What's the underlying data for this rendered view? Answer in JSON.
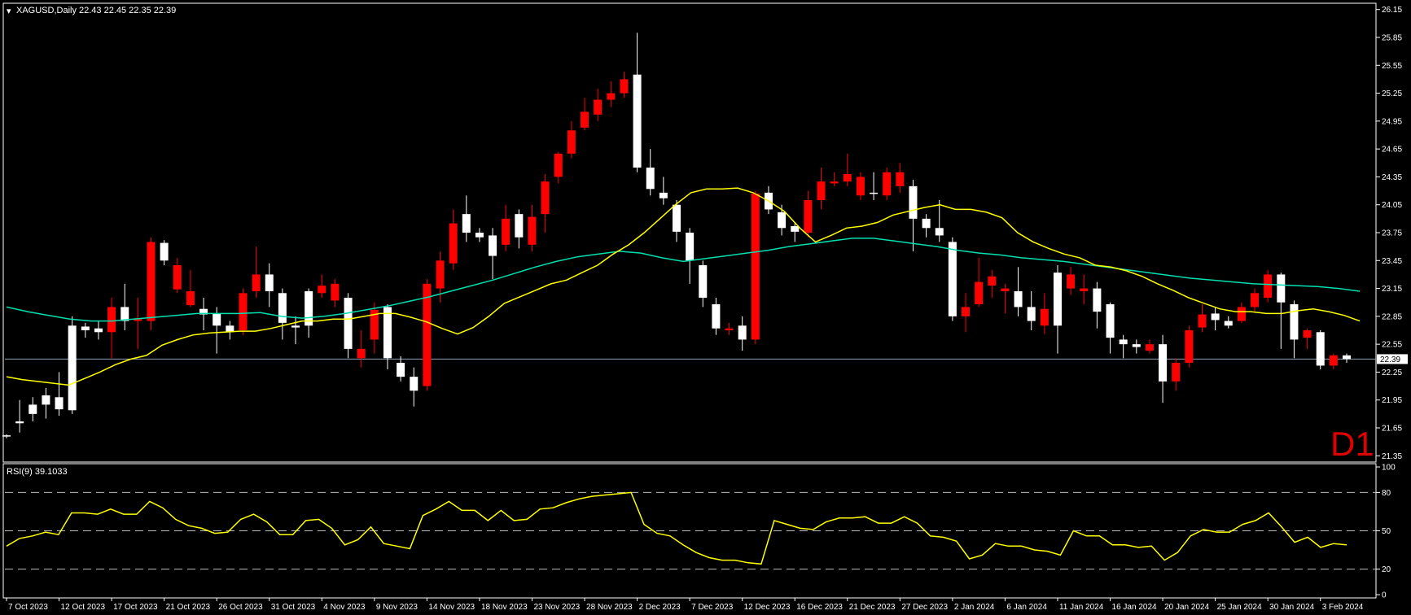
{
  "header": {
    "symbol_line": "XAGUSD,Daily  22.43 22.45 22.35 22.39",
    "timeframe_badge": "D1",
    "rsi_label": "RSI(9) 39.1033",
    "current_price_label": "22.39"
  },
  "colors": {
    "background": "#000000",
    "bull_candle": "#ffffff",
    "bear_candle": "#ff0000",
    "ma_fast": "#ffff00",
    "ma_slow": "#00e0b0",
    "rsi_line": "#ffff00",
    "grid_text": "#ffffff",
    "price_line": "#8fa3b8"
  },
  "chart_data": [
    {
      "type": "candlestick",
      "symbol": "XAGUSD",
      "period": "Daily",
      "ylim": [
        21.3,
        26.2
      ],
      "y_ticks": [
        "26.15",
        "25.85",
        "25.55",
        "25.25",
        "24.95",
        "24.65",
        "24.35",
        "24.05",
        "23.75",
        "23.45",
        "23.15",
        "22.85",
        "22.55",
        "22.25",
        "21.95",
        "21.65",
        "21.35"
      ],
      "x_labels": [
        "7 Oct 2023",
        "12 Oct 2023",
        "17 Oct 2023",
        "21 Oct 2023",
        "26 Oct 2023",
        "31 Oct 2023",
        "4 Nov 2023",
        "9 Nov 2023",
        "14 Nov 2023",
        "18 Nov 2023",
        "23 Nov 2023",
        "28 Nov 2023",
        "2 Dec 2023",
        "7 Dec 2023",
        "12 Dec 2023",
        "16 Dec 2023",
        "21 Dec 2023",
        "27 Dec 2023",
        "2 Jan 2024",
        "6 Jan 2024",
        "11 Jan 2024",
        "16 Jan 2024",
        "20 Jan 2024",
        "25 Jan 2024",
        "30 Jan 2024",
        "3 Feb 2024"
      ],
      "current_price": 22.39,
      "candles": [
        [
          21.56,
          21.58,
          21.54,
          21.57
        ],
        [
          21.7,
          21.95,
          21.6,
          21.72
        ],
        [
          21.8,
          21.98,
          21.72,
          21.9
        ],
        [
          21.9,
          22.08,
          21.75,
          22.0
        ],
        [
          21.85,
          22.25,
          21.78,
          21.98
        ],
        [
          21.84,
          22.85,
          21.8,
          22.75
        ],
        [
          22.7,
          22.78,
          22.62,
          22.74
        ],
        [
          22.68,
          22.8,
          22.6,
          22.72
        ],
        [
          22.95,
          23.05,
          22.4,
          22.68
        ],
        [
          22.8,
          23.2,
          22.7,
          22.95
        ],
        [
          22.82,
          23.05,
          22.5,
          22.8
        ],
        [
          23.65,
          23.7,
          22.7,
          22.8
        ],
        [
          23.45,
          23.67,
          23.4,
          23.64
        ],
        [
          23.4,
          23.48,
          23.1,
          23.14
        ],
        [
          23.12,
          23.35,
          22.95,
          22.97
        ],
        [
          22.87,
          23.05,
          22.7,
          22.93
        ],
        [
          22.75,
          22.95,
          22.45,
          22.88
        ],
        [
          22.68,
          22.8,
          22.6,
          22.75
        ],
        [
          23.1,
          23.15,
          22.65,
          22.7
        ],
        [
          23.3,
          23.6,
          23.05,
          23.12
        ],
        [
          23.12,
          23.42,
          22.95,
          23.3
        ],
        [
          22.78,
          23.15,
          22.6,
          23.1
        ],
        [
          22.73,
          22.85,
          22.55,
          22.75
        ],
        [
          22.75,
          23.15,
          22.62,
          23.12
        ],
        [
          23.18,
          23.3,
          23.05,
          23.1
        ],
        [
          23.2,
          23.25,
          22.95,
          23.02
        ],
        [
          22.5,
          23.1,
          22.4,
          23.05
        ],
        [
          22.5,
          22.7,
          22.3,
          22.4
        ],
        [
          22.92,
          23.0,
          22.45,
          22.6
        ],
        [
          22.4,
          22.98,
          22.28,
          22.95
        ],
        [
          22.2,
          22.42,
          22.15,
          22.35
        ],
        [
          22.05,
          22.3,
          21.88,
          22.2
        ],
        [
          23.2,
          23.25,
          22.05,
          22.1
        ],
        [
          23.45,
          23.55,
          23.0,
          23.15
        ],
        [
          23.85,
          24.0,
          23.35,
          23.42
        ],
        [
          23.75,
          24.15,
          23.65,
          23.95
        ],
        [
          23.7,
          23.8,
          23.65,
          23.75
        ],
        [
          23.5,
          23.8,
          23.25,
          23.72
        ],
        [
          23.9,
          24.05,
          23.55,
          23.62
        ],
        [
          23.7,
          24.0,
          23.58,
          23.95
        ],
        [
          23.92,
          24.05,
          23.55,
          23.62
        ],
        [
          24.3,
          24.38,
          23.75,
          23.95
        ],
        [
          24.6,
          24.62,
          24.28,
          24.35
        ],
        [
          24.85,
          24.95,
          24.55,
          24.6
        ],
        [
          25.05,
          25.2,
          24.85,
          24.88
        ],
        [
          25.18,
          25.3,
          24.95,
          25.02
        ],
        [
          25.25,
          25.38,
          25.1,
          25.18
        ],
        [
          25.4,
          25.48,
          25.2,
          25.25
        ],
        [
          24.45,
          25.9,
          24.4,
          25.45
        ],
        [
          24.22,
          24.65,
          24.15,
          24.45
        ],
        [
          24.12,
          24.35,
          24.05,
          24.18
        ],
        [
          23.76,
          24.1,
          23.65,
          24.05
        ],
        [
          23.45,
          23.8,
          23.2,
          23.75
        ],
        [
          23.05,
          23.45,
          22.95,
          23.4
        ],
        [
          22.72,
          23.05,
          22.65,
          22.98
        ],
        [
          22.72,
          22.78,
          22.65,
          22.7
        ],
        [
          22.6,
          22.85,
          22.48,
          22.75
        ],
        [
          24.17,
          24.2,
          22.55,
          22.6
        ],
        [
          24.0,
          24.25,
          23.95,
          24.18
        ],
        [
          23.8,
          24.05,
          23.72,
          23.97
        ],
        [
          23.76,
          23.85,
          23.65,
          23.82
        ],
        [
          24.1,
          24.2,
          23.7,
          23.75
        ],
        [
          24.3,
          24.45,
          24.0,
          24.1
        ],
        [
          24.3,
          24.4,
          24.25,
          24.28
        ],
        [
          24.38,
          24.6,
          24.25,
          24.3
        ],
        [
          24.35,
          24.4,
          24.1,
          24.15
        ],
        [
          24.17,
          24.4,
          24.1,
          24.18
        ],
        [
          24.4,
          24.45,
          24.1,
          24.15
        ],
        [
          24.4,
          24.5,
          24.18,
          24.25
        ],
        [
          23.9,
          24.32,
          23.55,
          24.25
        ],
        [
          23.8,
          23.95,
          23.7,
          23.9
        ],
        [
          23.72,
          24.1,
          23.65,
          23.8
        ],
        [
          22.85,
          23.7,
          22.8,
          23.65
        ],
        [
          22.95,
          23.1,
          22.68,
          22.85
        ],
        [
          23.22,
          23.48,
          22.95,
          22.98
        ],
        [
          23.28,
          23.35,
          23.05,
          23.18
        ],
        [
          23.15,
          23.2,
          22.88,
          23.12
        ],
        [
          22.95,
          23.38,
          22.85,
          23.12
        ],
        [
          22.8,
          23.12,
          22.7,
          22.95
        ],
        [
          22.93,
          23.1,
          22.66,
          22.75
        ],
        [
          22.75,
          23.4,
          22.45,
          23.32
        ],
        [
          23.3,
          23.38,
          23.08,
          23.15
        ],
        [
          23.15,
          23.3,
          22.98,
          23.12
        ],
        [
          22.9,
          23.22,
          22.72,
          23.15
        ],
        [
          22.62,
          23.0,
          22.45,
          22.98
        ],
        [
          22.55,
          22.65,
          22.4,
          22.6
        ],
        [
          22.52,
          22.6,
          22.45,
          22.55
        ],
        [
          22.55,
          22.6,
          22.45,
          22.48
        ],
        [
          22.15,
          22.65,
          21.92,
          22.55
        ],
        [
          22.35,
          22.4,
          22.05,
          22.15
        ],
        [
          22.7,
          22.75,
          22.3,
          22.35
        ],
        [
          22.87,
          22.98,
          22.68,
          22.73
        ],
        [
          22.81,
          22.95,
          22.7,
          22.88
        ],
        [
          22.75,
          22.85,
          22.72,
          22.8
        ],
        [
          22.95,
          23.0,
          22.78,
          22.8
        ],
        [
          23.1,
          23.15,
          22.9,
          22.95
        ],
        [
          23.3,
          23.35,
          23.0,
          23.05
        ],
        [
          23.0,
          23.32,
          22.5,
          23.3
        ],
        [
          22.6,
          23.02,
          22.4,
          22.98
        ],
        [
          22.7,
          22.72,
          22.5,
          22.62
        ],
        [
          22.32,
          22.7,
          22.28,
          22.68
        ],
        [
          22.43,
          22.45,
          22.28,
          22.32
        ],
        [
          22.39,
          22.45,
          22.35,
          22.43
        ]
      ],
      "ma_fast": [
        22.2,
        22.17,
        22.15,
        22.13,
        22.11,
        22.18,
        22.25,
        22.33,
        22.39,
        22.43,
        22.54,
        22.6,
        22.65,
        22.67,
        22.68,
        22.69,
        22.69,
        22.72,
        22.76,
        22.8,
        22.8,
        22.82,
        22.82,
        22.85,
        22.88,
        22.88,
        22.84,
        22.79,
        22.72,
        22.66,
        22.73,
        22.85,
        22.99,
        23.06,
        23.13,
        23.2,
        23.24,
        23.32,
        23.4,
        23.52,
        23.62,
        23.75,
        23.9,
        24.05,
        24.18,
        24.22,
        24.22,
        24.23,
        24.18,
        24.09,
        23.98,
        23.8,
        23.65,
        23.72,
        23.8,
        23.82,
        23.86,
        23.94,
        23.98,
        24.02,
        24.05,
        24.0,
        24.0,
        23.97,
        23.91,
        23.75,
        23.65,
        23.58,
        23.52,
        23.48,
        23.4,
        23.38,
        23.34,
        23.28,
        23.2,
        23.13,
        23.05,
        22.99,
        22.93,
        22.9,
        22.9,
        22.88,
        22.88,
        22.91,
        22.93,
        22.9,
        22.86,
        22.8
      ],
      "ma_slow": [
        22.95,
        22.9,
        22.86,
        22.82,
        22.8,
        22.8,
        22.82,
        22.84,
        22.86,
        22.88,
        22.88,
        22.88,
        22.89,
        22.85,
        22.83,
        22.85,
        22.88,
        22.92,
        22.96,
        23.01,
        23.06,
        23.12,
        23.18,
        23.24,
        23.31,
        23.38,
        23.44,
        23.49,
        23.52,
        23.55,
        23.53,
        23.48,
        23.44,
        23.47,
        23.5,
        23.53,
        23.56,
        23.6,
        23.63,
        23.66,
        23.69,
        23.69,
        23.66,
        23.63,
        23.6,
        23.56,
        23.53,
        23.51,
        23.48,
        23.46,
        23.44,
        23.41,
        23.38,
        23.35,
        23.32,
        23.29,
        23.26,
        23.24,
        23.22,
        23.2,
        23.19,
        23.18,
        23.17,
        23.15,
        23.12
      ],
      "ma_fast_range": [
        0,
        103
      ],
      "ma_slow_range": [
        0,
        103
      ]
    },
    {
      "type": "line",
      "name": "RSI(9)",
      "ylim": [
        0,
        100
      ],
      "y_ticks": [
        "100",
        "80",
        "50",
        "20",
        "0"
      ],
      "levels": [
        80,
        50,
        20
      ],
      "values": [
        38,
        44,
        46,
        49,
        47,
        64,
        64,
        63,
        67,
        63,
        63,
        73,
        68,
        59,
        54,
        52,
        48,
        49,
        59,
        63,
        57,
        47,
        47,
        58,
        59,
        52,
        39,
        43,
        53,
        40,
        38,
        36,
        62,
        67,
        73,
        66,
        66,
        58,
        66,
        58,
        59,
        67,
        68,
        72,
        75,
        77,
        78,
        79,
        80,
        55,
        48,
        46,
        39,
        33,
        29,
        27,
        27,
        25,
        24,
        58,
        55,
        52,
        51,
        57,
        60,
        60,
        61,
        56,
        56,
        61,
        56,
        46,
        45,
        42,
        28,
        31,
        40,
        38,
        38,
        35,
        34,
        31,
        50,
        46,
        46,
        39,
        39,
        37,
        38,
        27,
        33,
        46,
        51,
        49,
        49,
        55,
        58,
        64,
        53,
        41,
        45,
        37,
        40,
        39
      ]
    }
  ]
}
